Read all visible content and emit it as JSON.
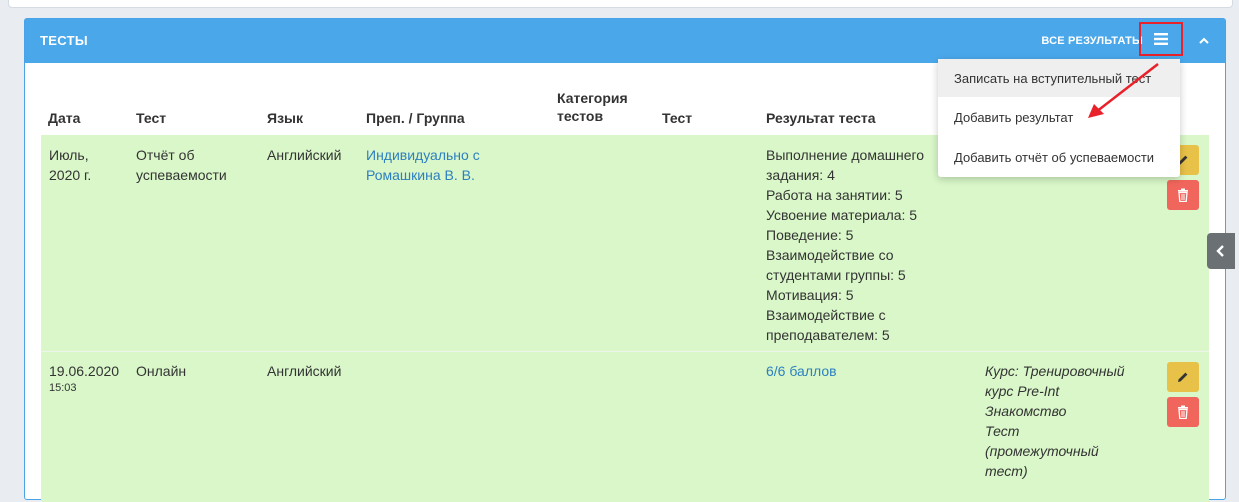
{
  "panel": {
    "title": "ТЕСТЫ",
    "all_results_label": "ВСЕ РЕЗУЛЬТАТЫ",
    "header_color": "#4aa8ea"
  },
  "table": {
    "headers": {
      "date": "Дата",
      "test": "Тест",
      "language": "Язык",
      "teacher_group": "Преп. / Группа",
      "category_line1": "Категория",
      "category_line2": "тестов",
      "test2": "Тест",
      "result": "Результат теста"
    },
    "rows": [
      {
        "date_line1": "Июль,",
        "date_line2": "2020 г.",
        "test_line1": "Отчёт об",
        "test_line2": "успеваемости",
        "language": "Английский",
        "teacher_line1": "Индивидуально с",
        "teacher_line2": "Ромашкина В. В.",
        "result_lines": [
          "Выполнение домашнего",
          "задания: 4",
          "Работа на занятии: 5",
          "Усвоение материала: 5",
          "Поведение: 5",
          "Взаимодействие со",
          "студентами группы: 5",
          "Мотивация: 5",
          "Взаимодействие с",
          "преподавателем: 5"
        ]
      },
      {
        "date_line1": "19.06.2020",
        "time": "15:03",
        "test_line1": "Онлайн",
        "language": "Английский",
        "result_link": "6/6 баллов",
        "comment_lines": [
          "Курс: Тренировочный",
          "курс Pre-Int",
          "Знакомство",
          "Тест",
          "(промежуточный",
          "тест)"
        ]
      }
    ],
    "row_color": "#d9f7c9"
  },
  "dropdown": {
    "items": [
      "Записать на вступительный тест",
      "Добавить результат",
      "Добавить отчёт об успеваемости"
    ]
  },
  "colors": {
    "accent": "#4aa8ea",
    "edit_button": "#e8c148",
    "delete_button": "#f0665c",
    "highlight": "#e8212a",
    "link": "#2d7fc0"
  },
  "icons": {
    "menu": "hamburger-icon",
    "collapse": "chevron-up-icon",
    "edit": "pencil-icon",
    "delete": "trash-icon",
    "side_tab": "chevron-left-icon",
    "annotation": "red-arrow"
  }
}
